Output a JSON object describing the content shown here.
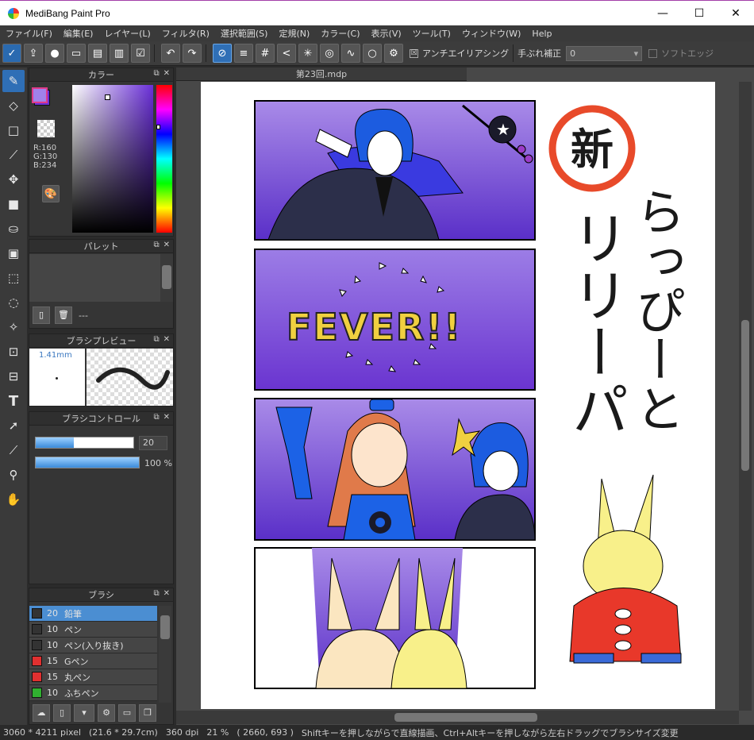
{
  "window": {
    "title": "MediBang Paint Pro",
    "minimize": "—",
    "maximize": "☐",
    "close": "✕"
  },
  "menu": [
    "ファイル(F)",
    "編集(E)",
    "レイヤー(L)",
    "フィルタ(R)",
    "選択範囲(S)",
    "定規(N)",
    "カラー(C)",
    "表示(V)",
    "ツール(T)",
    "ウィンドウ(W)",
    "Help"
  ],
  "toolbar": {
    "antialias_label": "アンチエイリアシング",
    "antialias_checked": "☒",
    "stabilizer_label": "手ぶれ補正",
    "stabilizer_value": "0",
    "soft_edge_label": "ソフトエッジ"
  },
  "color_panel": {
    "title": "カラー",
    "r": "R:160",
    "g": "G:130",
    "b": "B:234",
    "fg_color": "#a082ea",
    "bg_color": "#6a2fd8"
  },
  "palette_panel": {
    "title": "パレット",
    "dash": "---"
  },
  "brush_preview_panel": {
    "title": "ブラシプレビュー",
    "size_label": "1.41mm"
  },
  "brush_control_panel": {
    "title": "ブラシコントロール",
    "size_value": "20",
    "opacity_value": "100 %"
  },
  "brush_panel": {
    "title": "ブラシ",
    "items": [
      {
        "size": "20",
        "name": "鉛筆",
        "color": "#333333"
      },
      {
        "size": "10",
        "name": "ペン",
        "color": "#333333"
      },
      {
        "size": "10",
        "name": "ペン(入り抜き)",
        "color": "#333333"
      },
      {
        "size": "15",
        "name": "Gペン",
        "color": "#e03030"
      },
      {
        "size": "15",
        "name": "丸ペン",
        "color": "#e03030"
      },
      {
        "size": "10",
        "name": "ふちペン",
        "color": "#30b030"
      }
    ]
  },
  "document": {
    "tab_name": "第23回.mdp",
    "fever_text": "FEVER!!",
    "new_stamp": "新",
    "vertical_title_1": "らっぴーと",
    "vertical_title_2": "リリーパ"
  },
  "status": {
    "pixel_size": "3060 * 4211 pixel",
    "cm_size": "(21.6 * 29.7cm)",
    "dpi": "360 dpi",
    "zoom": "21 %",
    "coords": "( 2660, 693 )",
    "hint": "Shiftキーを押しながらで直線描画、Ctrl+Altキーを押しながら左右ドラッグでブラシサイズ変更"
  }
}
